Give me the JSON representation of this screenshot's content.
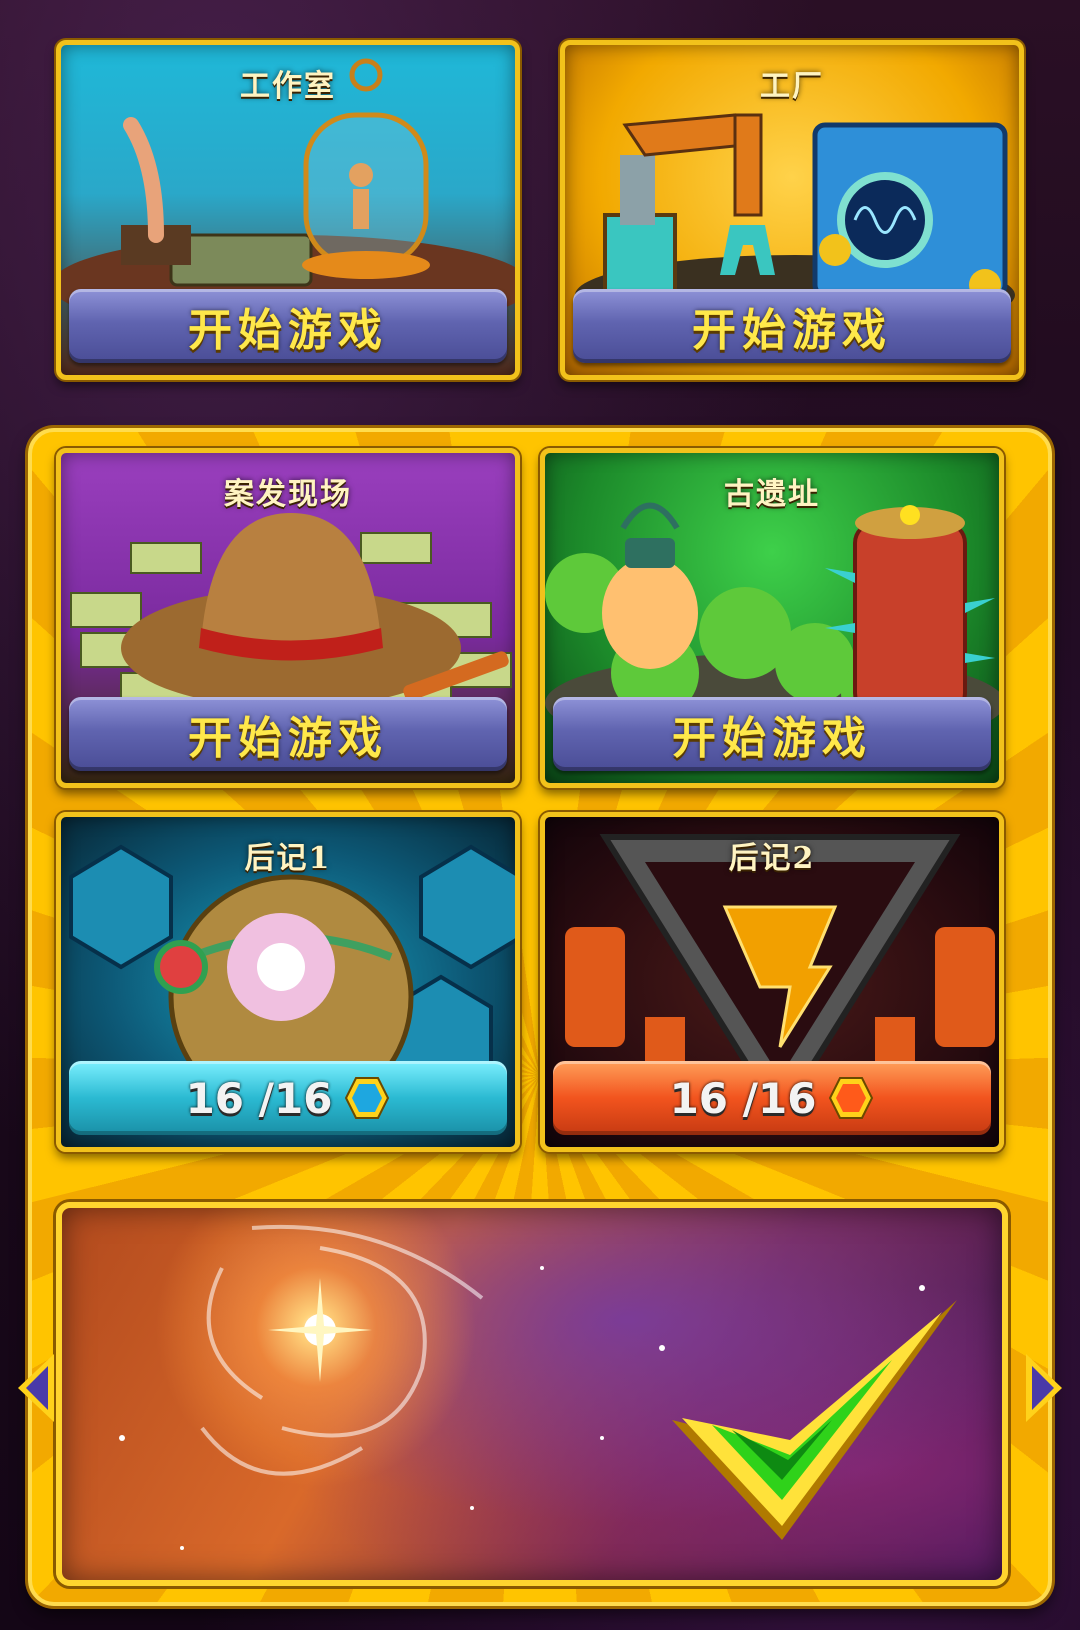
{
  "levels": [
    {
      "title": "工作室",
      "button_label": "开始游戏"
    },
    {
      "title": "工厂",
      "button_label": "开始游戏"
    },
    {
      "title": "案发现场",
      "button_label": "开始游戏"
    },
    {
      "title": "古遗址",
      "button_label": "开始游戏"
    },
    {
      "title": "后记1",
      "progress": "16 /16",
      "gem_color": "#1ea7e0"
    },
    {
      "title": "后记2",
      "progress": "16 /16",
      "gem_color": "#ff5a1a"
    }
  ],
  "colors": {
    "panel_yellow": "#ffc400",
    "button_purple": "#6064b0",
    "label_yellow": "#ffe84a",
    "checkmark_green": "#2fd21a"
  },
  "icons": {
    "left_arrow": "triangle-left",
    "right_arrow": "triangle-right",
    "confirm": "checkmark"
  }
}
